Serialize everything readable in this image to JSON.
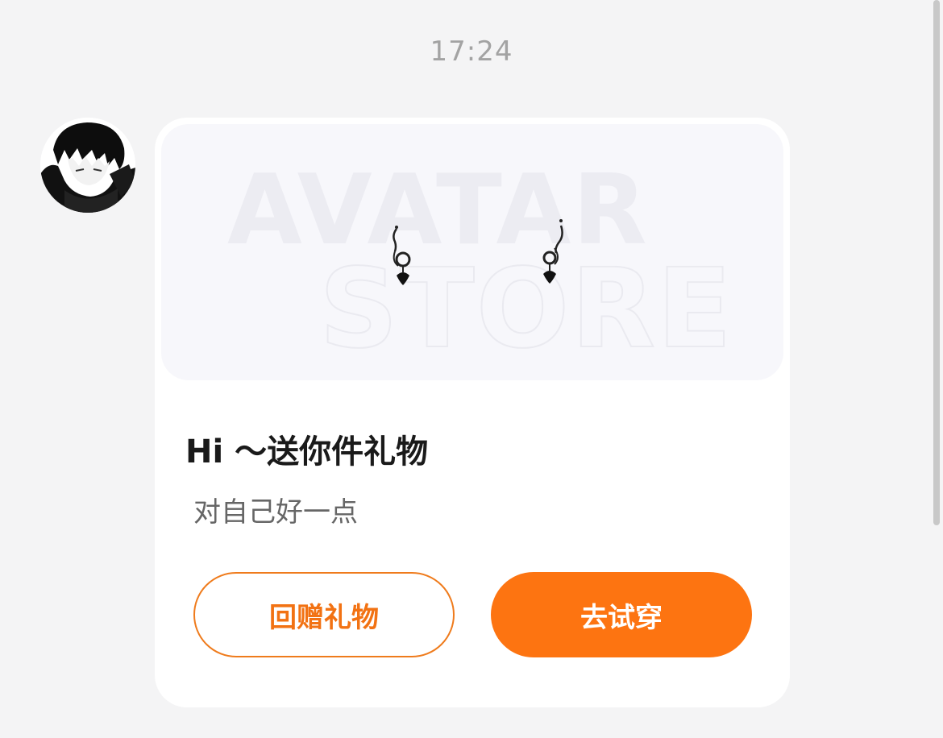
{
  "chat": {
    "timestamp": "17:24"
  },
  "message": {
    "sender_avatar": "anime-boy-avatar",
    "banner": {
      "word1": "AVATAR",
      "word2": "STORE",
      "item_icon": "earring-icon"
    },
    "title": "Hi ～送你件礼物",
    "subtitle": "对自己好一点",
    "buttons": {
      "return_gift": "回赠礼物",
      "try_on": "去试穿"
    }
  },
  "colors": {
    "accent": "#fd7411",
    "accent_border": "#ef7b1c",
    "background": "#f4f4f5",
    "card": "#ffffff"
  }
}
